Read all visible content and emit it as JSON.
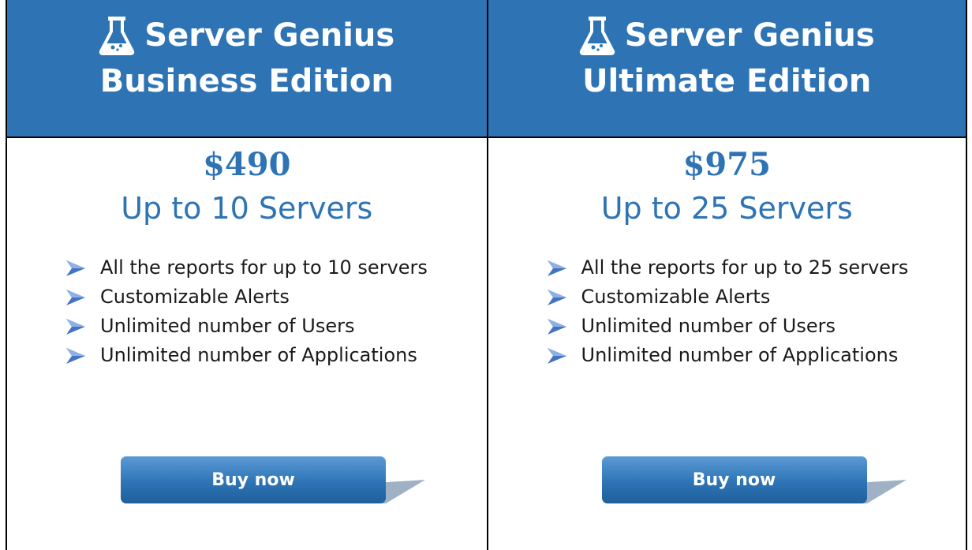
{
  "cards": [
    {
      "brand": "Server Genius",
      "edition": "Business Edition",
      "price": "$490",
      "servers": "Up to 10 Servers",
      "features": [
        "All the reports for up to 10 servers",
        "Customizable Alerts",
        "Unlimited number of Users",
        "Unlimited number of Applications"
      ],
      "button_label": "Buy now"
    },
    {
      "brand": "Server Genius",
      "edition": "Ultimate Edition",
      "price": "$975",
      "servers": "Up to 25 Servers",
      "features": [
        "All the reports for up to 25 servers",
        "Customizable Alerts",
        "Unlimited number of Users",
        "Unlimited number of Applications"
      ],
      "button_label": "Buy now"
    }
  ],
  "icons": {
    "logo": "flask-icon",
    "bullet": "arrow-right-icon"
  },
  "colors": {
    "header_bg": "#2e74b5",
    "accent_text": "#2e74b5",
    "button": "#2e74b5"
  }
}
